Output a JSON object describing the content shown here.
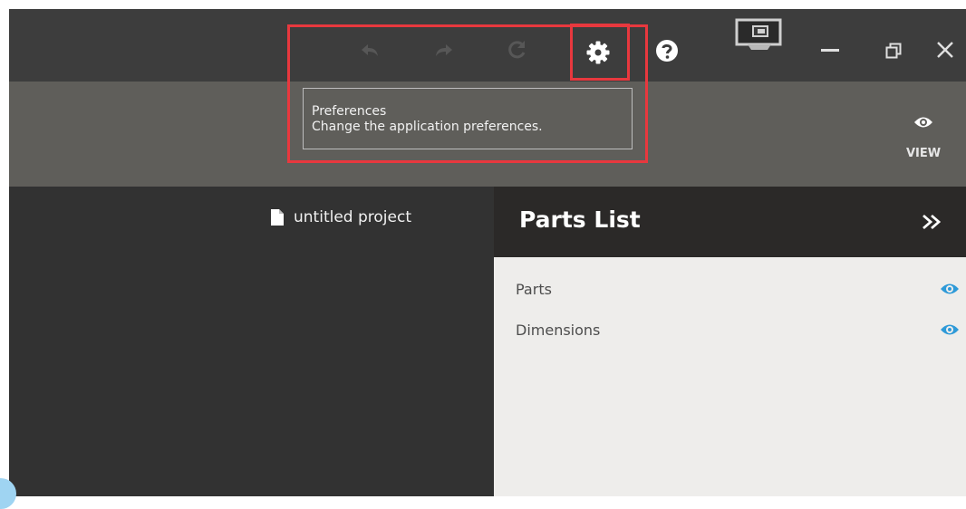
{
  "toolbar": {
    "undo_icon": "undo-icon",
    "redo_icon": "redo-icon",
    "sync_icon": "sync-icon",
    "preferences_icon": "gear-icon",
    "help_icon": "help-icon",
    "view_label": "VIEW"
  },
  "tooltip": {
    "title": "Preferences",
    "description": "Change the application preferences."
  },
  "project": {
    "name": "untitled project"
  },
  "parts_list": {
    "title": "Parts List",
    "items": [
      {
        "label": "Parts",
        "visible": true
      },
      {
        "label": "Dimensions",
        "visible": true
      }
    ]
  },
  "colors": {
    "highlight": "#e8383e",
    "eye_blue": "#2e9ad8",
    "titlebar": "#3d3d3d",
    "toolbar": "#5f5e5a",
    "canvas": "#323232",
    "panel": "#eeedeb"
  }
}
